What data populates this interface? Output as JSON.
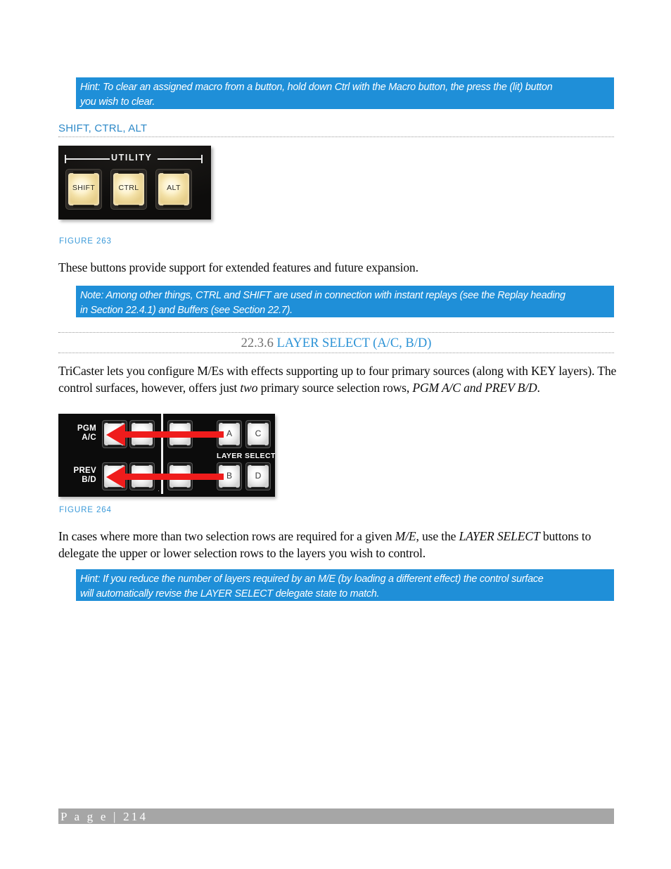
{
  "document": {
    "page_footer": "P a g e  |  214",
    "accent_blue": "#2d93d6",
    "callout_bg": "#1f8fd8",
    "footer_bg": "#a6a6a6"
  },
  "hint_macro": {
    "line1": "Hint: To clear an assigned macro from a button, hold down Ctrl with the Macro button, the press the (lit) button",
    "line2": "you wish to clear."
  },
  "subheading": {
    "label": "SHIFT, CTRL, ALT"
  },
  "figure_263": {
    "caption": "FIGURE 263",
    "panel_label": "UTILITY",
    "buttons": [
      {
        "label": "SHIFT"
      },
      {
        "label": "CTRL"
      },
      {
        "label": "ALT"
      }
    ]
  },
  "paragraph_1": {
    "text": "These buttons provide support for extended features and future expansion."
  },
  "note_ctrl_shift": {
    "line1": "Note: Among other things, CTRL and SHIFT are used in connection with instant replays (see the Replay heading",
    "line2": "in Section 22.4.1) and Buffers (see Section 22.7)."
  },
  "section_heading": {
    "number": "22.3.6",
    "title": "LAYER SELECT (A/C, B/D)"
  },
  "paragraph_2": {
    "line1_a": "TriCaster lets you configure M/Es with effects supporting up to four primary sources (along with KEY layers).",
    "line2_a": "The control surfaces, however, offers just ",
    "line2_i1": "two",
    "line2_b": " primary source selection rows, ",
    "line2_i2": "PGM A/C and PREV B/D",
    "line2_c": "."
  },
  "figure_264": {
    "caption": "FIGURE 264",
    "row_labels": [
      {
        "line1": "PGM",
        "line2": "A/C"
      },
      {
        "line1": "PREV",
        "line2": "B/D"
      }
    ],
    "layer_select_label": "LAYER SELECT",
    "layer_buttons": [
      {
        "label": "A"
      },
      {
        "label": "C"
      },
      {
        "label": "B"
      },
      {
        "label": "D"
      }
    ],
    "arrow_color": "#ef1c1c"
  },
  "paragraph_3": {
    "line1_a": "In cases where more than two selection rows are required for a given ",
    "line1_i1": "M/E",
    "line1_b": ", use the ",
    "line1_i2": "LAYER SELECT",
    "line1_c": " buttons to",
    "line2": "delegate the upper or lower selection rows to the layers you wish to control."
  },
  "hint_layers": {
    "line1": "Hint: If you reduce the number of layers required by an M/E (by loading a different effect) the control surface",
    "line2": "will automatically revise the LAYER SELECT delegate state to match."
  }
}
